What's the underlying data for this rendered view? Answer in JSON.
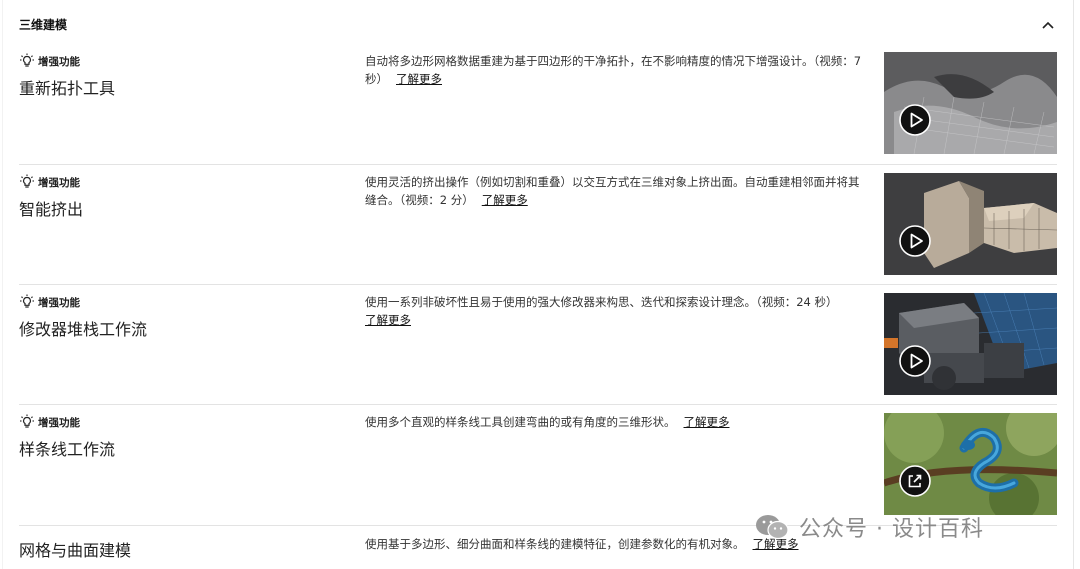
{
  "section": {
    "title": "三维建模"
  },
  "features": [
    {
      "badge": "增强功能",
      "name": "重新拓扑工具",
      "desc": "自动将多边形网格数据重建为基于四边形的干净拓扑，在不影响精度的情况下增强设计。（视频：7 秒）",
      "link": "了解更多",
      "media": "play-icon"
    },
    {
      "badge": "增强功能",
      "name": "智能挤出",
      "desc": "使用灵活的挤出操作（例如切割和重叠）以交互方式在三维对象上挤出面。自动重建相邻面并将其缝合。（视频：2 分）",
      "link": "了解更多",
      "media": "play-icon"
    },
    {
      "badge": "增强功能",
      "name": "修改器堆栈工作流",
      "desc": "使用一系列非破坏性且易于使用的强大修改器来构思、迭代和探索设计理念。（视频：24 秒）",
      "link": "了解更多",
      "media": "play-icon"
    },
    {
      "badge": "增强功能",
      "name": "样条线工作流",
      "desc": "使用多个直观的样条线工具创建弯曲的或有角度的三维形状。",
      "link": "了解更多",
      "media": "external-link-icon"
    }
  ],
  "last_feature": {
    "name": "网格与曲面建模",
    "desc": "使用基于多边形、细分曲面和样条线的建模特征，创建参数化的有机对象。",
    "link": "了解更多"
  },
  "watermark": {
    "text": "公众号 · 设计百科"
  },
  "colors": {
    "text": "#1a1a1a",
    "divider": "#e3e3e3",
    "play_bg": "#111111"
  }
}
